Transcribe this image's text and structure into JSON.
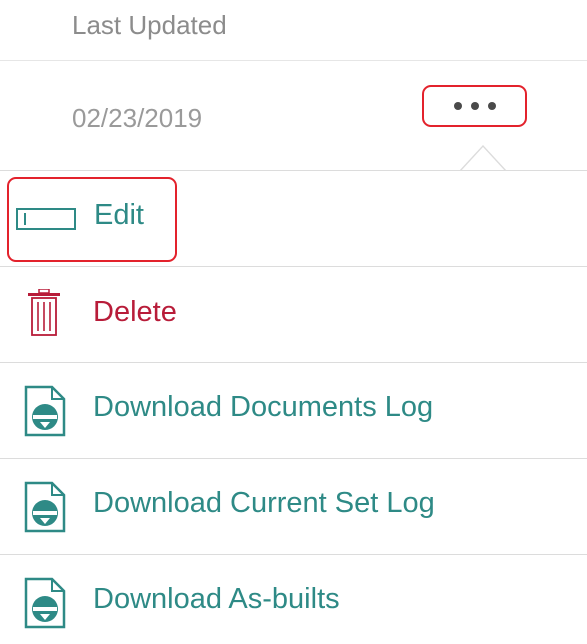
{
  "table": {
    "column_header": "Last Updated",
    "row_date": "02/23/2019"
  },
  "actions_menu": {
    "trigger_icon": "ellipsis-icon",
    "items": [
      {
        "label": "Edit",
        "icon": "edit-icon",
        "color": "#2e8a86"
      },
      {
        "label": "Delete",
        "icon": "trash-icon",
        "color": "#b81c39"
      },
      {
        "label": "Download Documents Log",
        "icon": "document-download-icon",
        "color": "#2e8a86"
      },
      {
        "label": "Download Current Set Log",
        "icon": "document-download-icon",
        "color": "#2e8a86"
      },
      {
        "label": "Download As-builts",
        "icon": "document-download-icon",
        "color": "#2e8a86"
      }
    ]
  },
  "highlight_color": "#e3222c"
}
